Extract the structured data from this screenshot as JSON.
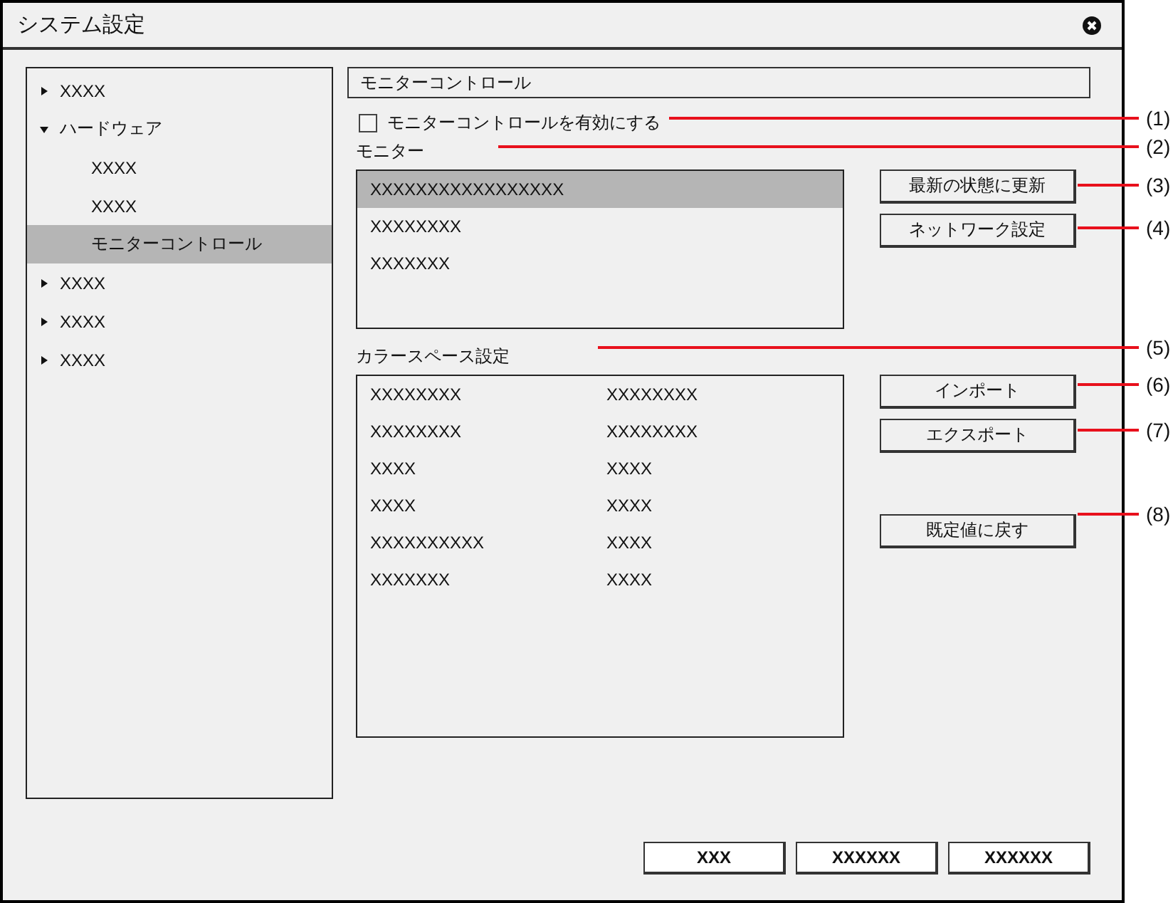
{
  "window": {
    "title": "システム設定"
  },
  "tree": [
    {
      "label": "XXXX",
      "expanded": false,
      "selected": false
    },
    {
      "label": "ハードウェア",
      "expanded": true,
      "selected": false,
      "children": [
        {
          "label": "XXXX",
          "selected": false
        },
        {
          "label": "XXXX",
          "selected": false
        },
        {
          "label": "モニターコントロール",
          "selected": true
        }
      ]
    },
    {
      "label": "XXXX",
      "expanded": false,
      "selected": false
    },
    {
      "label": "XXXX",
      "expanded": false,
      "selected": false
    },
    {
      "label": "XXXX",
      "expanded": false,
      "selected": false
    }
  ],
  "section_title": "モニターコントロール",
  "enable_checkbox": {
    "label": "モニターコントロールを有効にする",
    "checked": false
  },
  "monitor": {
    "label": "モニター",
    "items": [
      {
        "label": "XXXXXXXXXXXXXXXXX",
        "selected": true
      },
      {
        "label": "XXXXXXXX",
        "selected": false
      },
      {
        "label": "XXXXXXX",
        "selected": false
      }
    ],
    "buttons": [
      "最新の状態に更新",
      "ネットワーク設定"
    ]
  },
  "color_space": {
    "label": "カラースペース設定",
    "rows": [
      [
        "XXXXXXXX",
        "XXXXXXXX"
      ],
      [
        "XXXXXXXX",
        "XXXXXXXX"
      ],
      [
        "XXXX",
        "XXXX"
      ],
      [
        "XXXX",
        "XXXX"
      ],
      [
        "XXXXXXXXXX",
        "XXXX"
      ],
      [
        "XXXXXXX",
        "XXXX"
      ]
    ],
    "buttons": [
      "インポート",
      "エクスポート",
      "既定値に戻す"
    ]
  },
  "footer_buttons": [
    "XXX",
    "XXXXXX",
    "XXXXXX"
  ],
  "callouts": [
    "(1)",
    "(2)",
    "(3)",
    "(4)",
    "(5)",
    "(6)",
    "(7)",
    "(8)"
  ]
}
